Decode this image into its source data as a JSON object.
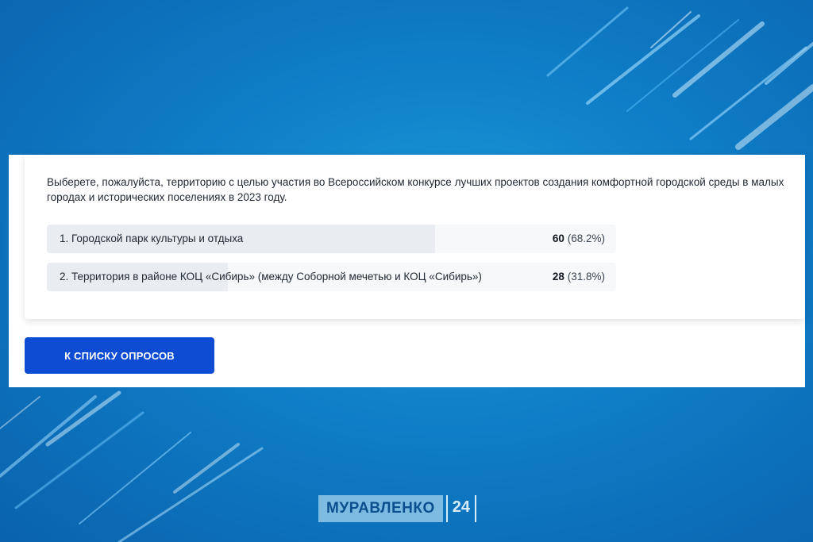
{
  "poll": {
    "question": "Выберете, пожалуйста, территорию с целью участия во Всероссийском конкурсе лучших проектов создания комфортной городской среды в малых городах и исторических поселениях в 2023 году.",
    "options": [
      {
        "label": "1. Городской парк культуры и отдыха",
        "votes": "60",
        "percent_text": "(68.2%)",
        "share": 0.682
      },
      {
        "label": "2. Территория в районе КОЦ «Сибирь» (между Соборной мечетью и КОЦ «Сибирь»)",
        "votes": "28",
        "percent_text": "(31.8%)",
        "share": 0.318
      }
    ]
  },
  "actions": {
    "back_label": "К СПИСКУ ОПРОСОВ"
  },
  "branding": {
    "name": "МУРАВЛЕНКО",
    "number": "24"
  },
  "colors": {
    "accent": "#0d4cd3",
    "background": "#0f7dc7"
  }
}
